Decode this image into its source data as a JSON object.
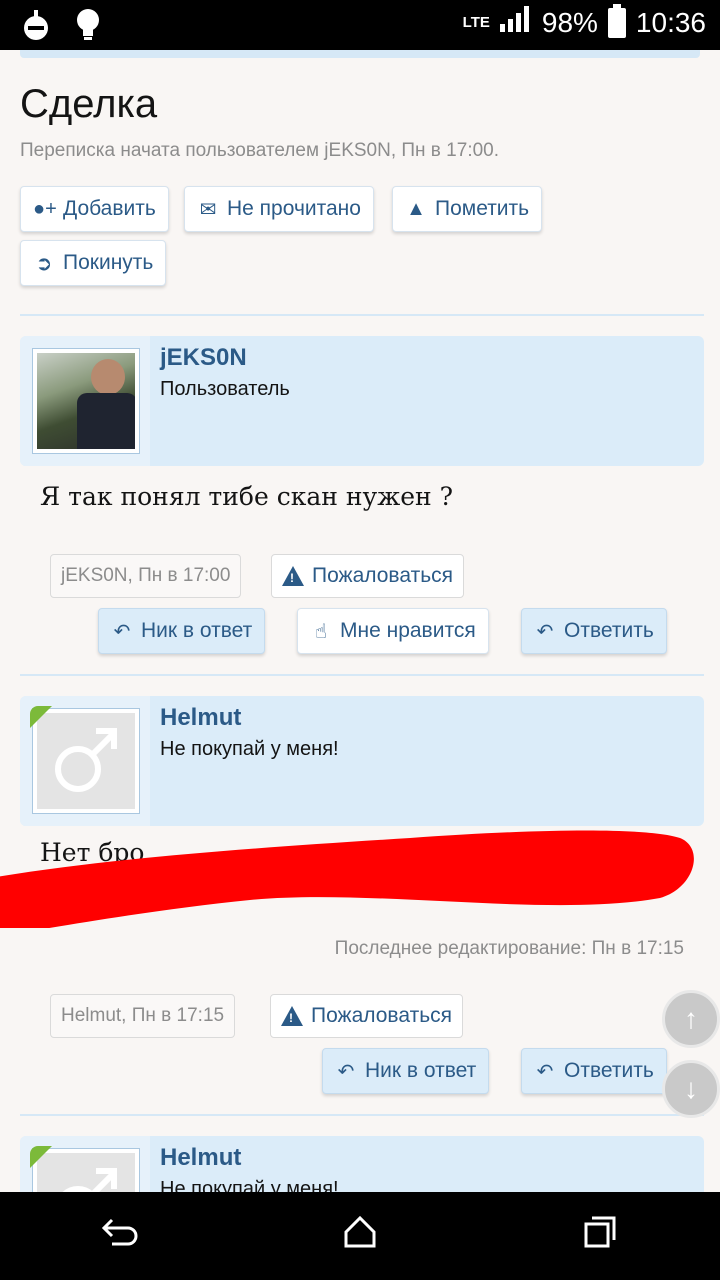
{
  "status_bar": {
    "network": "LTE",
    "battery": "98%",
    "time": "10:36",
    "icons": [
      "notification-icon",
      "lightbulb-icon",
      "signal-icon",
      "battery-icon"
    ]
  },
  "conversation": {
    "title": "Сделка",
    "subtitle": "Переписка начата пользователем jEKS0N, Пн в 17:00.",
    "actions": {
      "add": "Добавить",
      "unread": "Не прочитано",
      "mark": "Пометить",
      "leave": "Покинуть"
    }
  },
  "messages": [
    {
      "user": "jEKS0N",
      "user_title": "Пользователь",
      "text": "Я так понял тибе скан нужен ?",
      "meta": "jEKS0N, Пн в 17:00",
      "report": "Пожаловаться",
      "buttons": {
        "quote": "Ник в ответ",
        "like": "Мне нравится",
        "reply": "Ответить"
      }
    },
    {
      "user": "Helmut",
      "user_title": "Не покупай у меня!",
      "text": "Нет бро",
      "edit_note": "Последнее редактирование: Пн в 17:15",
      "meta": "Helmut, Пн в 17:15",
      "report": "Пожаловаться",
      "buttons": {
        "quote": "Ник в ответ",
        "reply": "Ответить"
      }
    },
    {
      "user": "Helmut",
      "user_title": "Не покупай у меня!"
    }
  ],
  "colors": {
    "accent": "#2b5a87",
    "panel": "#dbecf9",
    "online": "#7cba3a",
    "redaction": "#ff0000"
  }
}
